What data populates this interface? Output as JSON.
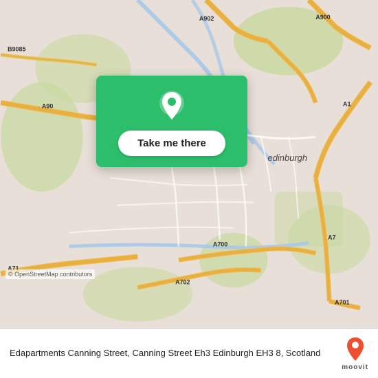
{
  "map": {
    "attribution": "© OpenStreetMap contributors",
    "center_label": "Edinburgh"
  },
  "card": {
    "button_label": "Take me there",
    "pin_color": "#ffffff"
  },
  "bottom_bar": {
    "address": "Edapartments Canning Street, Canning Street Eh3 Edinburgh EH3 8, Scotland",
    "logo_text": "moovit"
  }
}
